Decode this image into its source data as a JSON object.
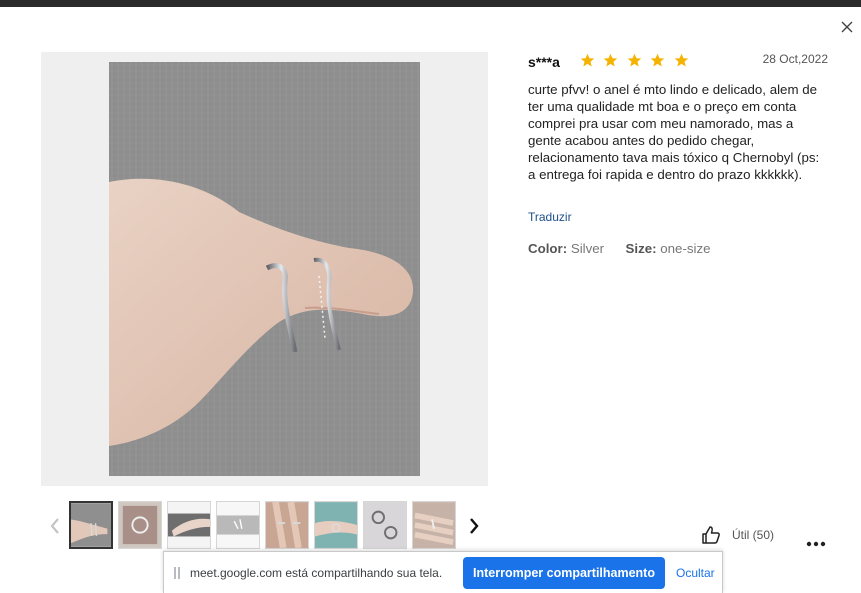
{
  "review": {
    "reviewer": "s***a",
    "rating": 5,
    "rating_max": 5,
    "date": "28 Oct,2022",
    "text": "curte pfvv! o anel é mto lindo e delicado, alem de ter uma qualidade mt boa e o preço em conta comprei pra usar com meu namorado, mas a gente acabou antes do pedido chegar, relacionamento tava mais tóxico q Chernobyl (ps: a entrega foi rapida e dentro do prazo kkkkkk).",
    "translate_label": "Traduzir",
    "color_key": "Color:",
    "color_value": "Silver",
    "size_key": "Size:",
    "size_value": "one-size"
  },
  "helpful": {
    "label": "Útil (50)"
  },
  "gallery": {
    "thumb_count": 8,
    "selected_index": 0,
    "icons": {
      "prev": "chevron-left-icon",
      "next": "chevron-right-icon",
      "close": "close-icon"
    }
  },
  "share_bar": {
    "message": "meet.google.com está compartilhando sua tela.",
    "stop_label": "Interromper compartilhamento",
    "hide_label": "Ocultar"
  },
  "colors": {
    "star": "#f5b301",
    "link": "#1f4f8c",
    "share_button": "#1a73e8",
    "photo_background": "#8f8f8f"
  }
}
